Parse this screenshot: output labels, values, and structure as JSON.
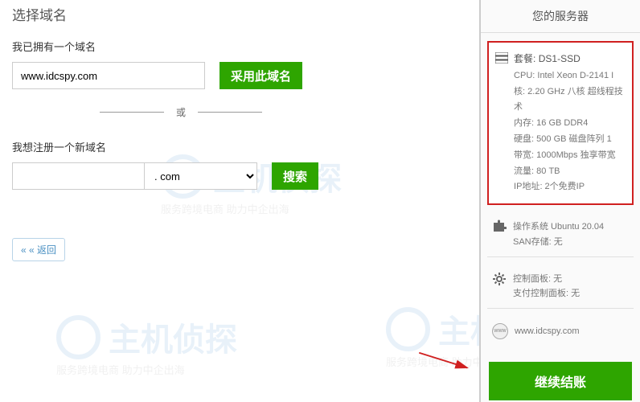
{
  "page_title": "选择域名",
  "existing_domain": {
    "label": "我已拥有一个域名",
    "value": "www.idcspy.com",
    "button": "采用此域名"
  },
  "divider": "或",
  "new_domain": {
    "label": "我想注册一个新域名",
    "value": "",
    "tld": ". com",
    "button": "搜索"
  },
  "back_button": "« « 返回",
  "sidebar": {
    "title": "您的服务器",
    "server": {
      "plan_label": "套餐:",
      "plan": "DS1-SSD",
      "specs": [
        "CPU: Intel Xeon D-2141 I",
        "核: 2.20 GHz 八核 超线程技术",
        "内存: 16 GB DDR4",
        "硬盘: 500 GB 磁盘阵列 1",
        "带宽: 1000Mbps 独享带宽",
        "流量: 80 TB",
        "IP地址: 2个免费IP"
      ]
    },
    "os": {
      "line1": "操作系统 Ubuntu 20.04",
      "line2": "SAN存储: 无"
    },
    "panel": {
      "line1": "控制面板: 无",
      "line2": "支付控制面板: 无"
    },
    "domain": "www.idcspy.com",
    "checkout": "继续结账"
  },
  "watermark": {
    "brand": "主机侦探",
    "tagline": "服务跨境电商 助力中企出海"
  }
}
